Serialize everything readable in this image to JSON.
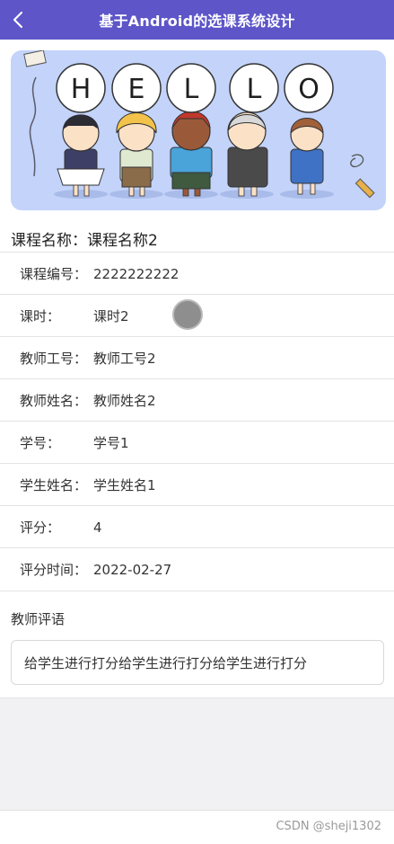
{
  "header": {
    "title": "基于Android的选课系统设计",
    "back_icon": "chevron-left-icon"
  },
  "banner": {
    "letters": [
      "H",
      "E",
      "L",
      "L",
      "O"
    ]
  },
  "course": {
    "name_label": "课程名称：",
    "name_value": "课程名称2"
  },
  "fields": [
    {
      "label": "课程编号：",
      "value": "2222222222"
    },
    {
      "label": "课时：",
      "value": "课时2"
    },
    {
      "label": "教师工号：",
      "value": "教师工号2"
    },
    {
      "label": "教师姓名：",
      "value": "教师姓名2"
    },
    {
      "label": "学号：",
      "value": "学号1"
    },
    {
      "label": "学生姓名：",
      "value": "学生姓名1"
    },
    {
      "label": "评分：",
      "value": "4"
    },
    {
      "label": "评分时间：",
      "value": "2022-02-27"
    }
  ],
  "comment": {
    "label": "教师评语",
    "value": "给学生进行打分给学生进行打分给学生进行打分"
  },
  "footer": {
    "watermark": "CSDN @sheji1302"
  },
  "colors": {
    "header_bg": "#5d55c8",
    "banner_bg": "#c3d3fa"
  }
}
